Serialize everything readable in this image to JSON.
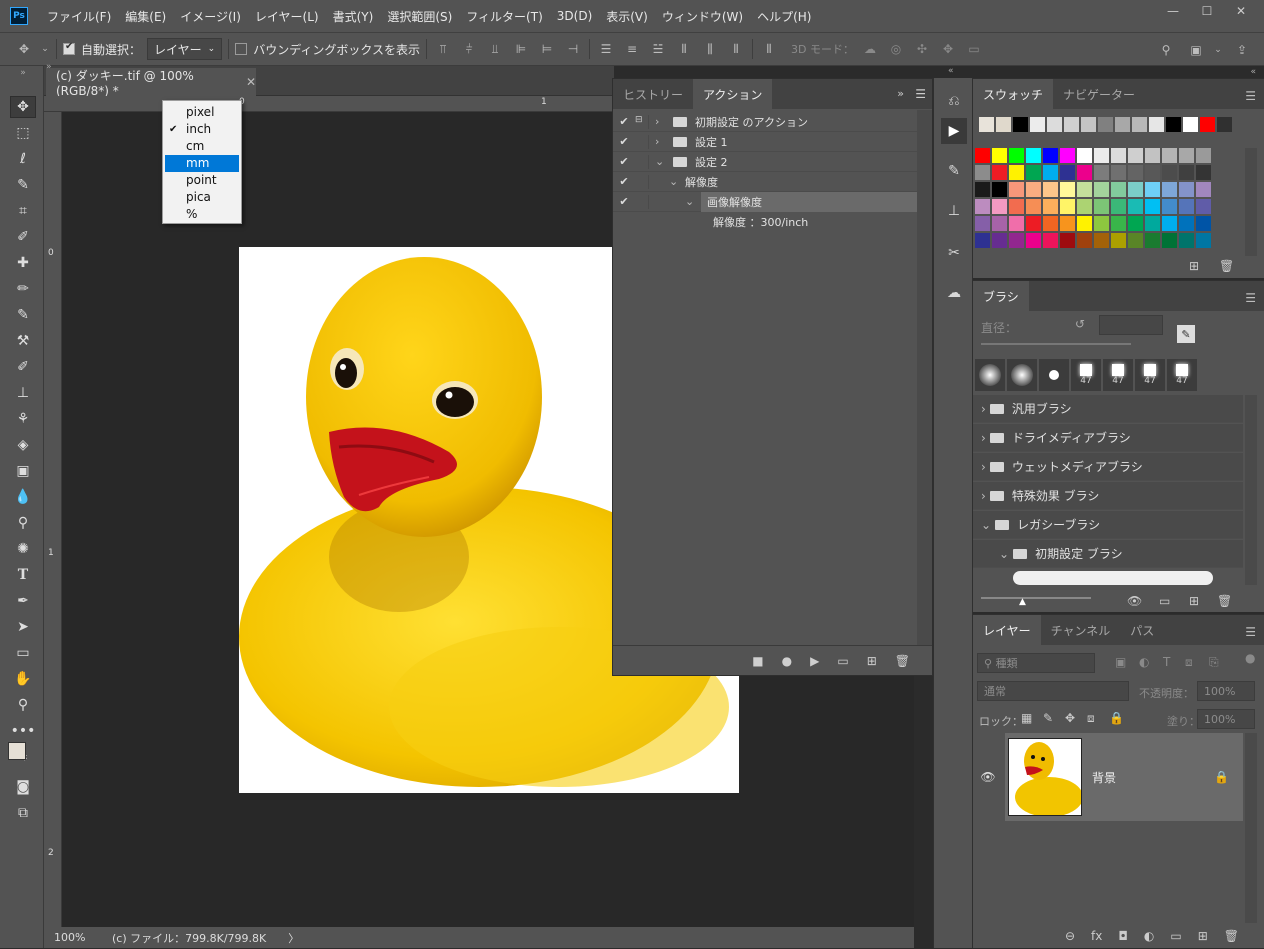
{
  "menubar": {
    "logo": "Ps",
    "items": [
      "ファイル(F)",
      "編集(E)",
      "イメージ(I)",
      "レイヤー(L)",
      "書式(Y)",
      "選択範囲(S)",
      "フィルター(T)",
      "3D(D)",
      "表示(V)",
      "ウィンドウ(W)",
      "ヘルプ(H)"
    ],
    "window_buttons": [
      "—",
      "☐",
      "✕"
    ]
  },
  "options": {
    "auto_select_label": "自動選択：",
    "auto_select_value": "レイヤー",
    "bounding_box_label": "バウンディングボックスを表示",
    "mode_3d_label": "3D モード："
  },
  "document": {
    "tab_title": "(c) ダッキー.tif @ 100% (RGB/8*) *",
    "ruler_marks": [
      "0",
      "1",
      "0",
      "1",
      "2"
    ]
  },
  "units_dropdown": {
    "items": [
      "pixel",
      "inch",
      "cm",
      "mm",
      "point",
      "pica",
      "%"
    ],
    "checked": "inch",
    "highlighted": "mm"
  },
  "status": {
    "zoom": "100%",
    "file_info": "(c) ファイル：799.8K/799.8K",
    "arrow": "〉"
  },
  "actions_panel": {
    "tabs": [
      "ヒストリー",
      "アクション"
    ],
    "rows": [
      {
        "label": "初期設定 のアクション",
        "check": "✔",
        "indent": 0,
        "arrow": "›"
      },
      {
        "label": "設定 1",
        "check": "✔",
        "indent": 0,
        "arrow": "›"
      },
      {
        "label": "設定 2",
        "check": "✔",
        "indent": 0,
        "arrow": "⌄"
      },
      {
        "label": "解像度",
        "check": "✔",
        "indent": 1,
        "arrow": "⌄"
      },
      {
        "label": "画像解像度",
        "check": "✔",
        "indent": 2,
        "arrow": "⌄"
      },
      {
        "label": "解像度 ：300/inch",
        "check": "",
        "indent": 3,
        "arrow": ""
      }
    ],
    "footer_icons": [
      "■",
      "●",
      "▶",
      "▭",
      "⊞",
      "🗑"
    ]
  },
  "swatches_panel": {
    "tabs": [
      "スウォッチ",
      "ナビゲーター"
    ],
    "recent": [
      "#e8e3da",
      "#e0d9cc",
      "#000000",
      "#ececec",
      "#dcdcdc",
      "#d0d0d0",
      "#c4c4c4",
      "#808080",
      "#a8a8a8",
      "#b8b8b8",
      "#e6e6e6",
      "#000000",
      "#ffffff",
      "#ff0000",
      "#303030"
    ],
    "grid": [
      [
        "#ff0000",
        "#ffff00",
        "#00ff00",
        "#00ffff",
        "#0000ff",
        "#ff00ff",
        "#ffffff",
        "#ececec",
        "#dcdcdc",
        "#cfcfcf",
        "#c2c2c2",
        "#b4b4b4",
        "#a8a8a8",
        "#9a9a9a"
      ],
      [
        "#8c8c8c",
        "#ef1c24",
        "#fff200",
        "#00a651",
        "#00aeef",
        "#2e3192",
        "#ec008c",
        "#7c7c7c",
        "#707070",
        "#646464",
        "#585858",
        "#4c4c4c",
        "#404040",
        "#343434"
      ],
      [
        "#1a1a1a",
        "#000000",
        "#f7977a",
        "#f9ad81",
        "#fdc68a",
        "#fff79a",
        "#c4df9b",
        "#a3d39c",
        "#82ca9d",
        "#7bcdc8",
        "#6ecff6",
        "#7ea7d8",
        "#8493ca",
        "#a187be"
      ],
      [
        "#bc8cbf",
        "#f49ac2",
        "#f26c4f",
        "#f68e55",
        "#fbaf5c",
        "#fff467",
        "#acd372",
        "#7cc576",
        "#3bb878",
        "#1abbb4",
        "#00bff3",
        "#438ccb",
        "#5574b9",
        "#605ca8"
      ],
      [
        "#855fa8",
        "#a763a8",
        "#f06eaa",
        "#ed1c24",
        "#f26522",
        "#f7941d",
        "#fff200",
        "#8dc73f",
        "#39b54a",
        "#00a651",
        "#00a99d",
        "#00aeef",
        "#0072bc",
        "#0054a6"
      ],
      [
        "#2e3192",
        "#662d91",
        "#92278f",
        "#ec008c",
        "#ed145b",
        "#9e0b0f",
        "#a0410d",
        "#a36209",
        "#aba000",
        "#598527",
        "#1a7b30",
        "#007236",
        "#00746b",
        "#0076a3"
      ]
    ]
  },
  "brush_panel": {
    "title": "ブラシ",
    "diameter_label": "直径：",
    "presets": [
      "",
      "",
      "",
      "47",
      "47",
      "47",
      "47"
    ],
    "folders": [
      "汎用ブラシ",
      "ドライメディアブラシ",
      "ウェットメディアブラシ",
      "特殊効果 ブラシ",
      "レガシーブラシ",
      "初期設定 ブラシ"
    ]
  },
  "layers_panel": {
    "tabs": [
      "レイヤー",
      "チャンネル",
      "パス"
    ],
    "filter_label": "種類",
    "blend_mode": "通常",
    "opacity_label": "不透明度：",
    "opacity_value": "100%",
    "lock_label": "ロック：",
    "fill_label": "塗り：",
    "fill_value": "100%",
    "layer_name": "背景",
    "footer_icons": [
      "⊖",
      "fx",
      "◘",
      "◐",
      "▭",
      "⊞",
      "🗑"
    ]
  },
  "colors": {
    "ui_bg": "#535353",
    "duck_yellow": "#f2c500",
    "beak_red": "#c4121b"
  }
}
